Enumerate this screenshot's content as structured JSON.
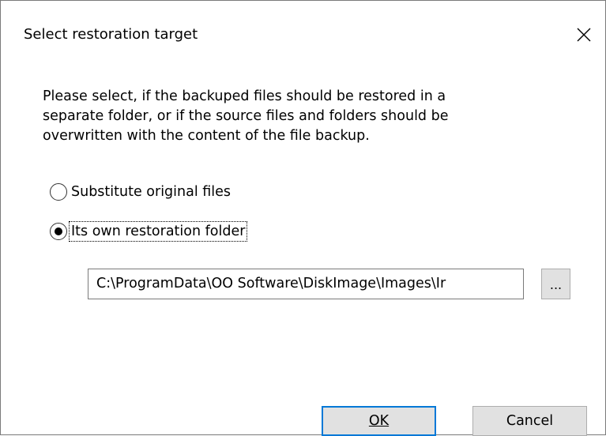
{
  "dialog": {
    "title": "Select restoration target",
    "message_lines": [
      "Please select, if the backuped files should be restored in a",
      "separate folder, or if the source files and folders should be",
      "overwritten with the content of the file backup."
    ],
    "options": [
      {
        "label": "Substitute original files",
        "selected": false
      },
      {
        "label": "Its own restoration folder",
        "selected": true
      }
    ],
    "path_value": "C:\\ProgramData\\OO Software\\DiskImage\\Images\\Ir",
    "browse_label": "...",
    "ok_label": "OK",
    "cancel_label": "Cancel"
  },
  "icons": {
    "close": "close-icon"
  },
  "colors": {
    "accent": "#0078d7",
    "button_face": "#e1e1e1",
    "border": "#7a7a7a"
  }
}
